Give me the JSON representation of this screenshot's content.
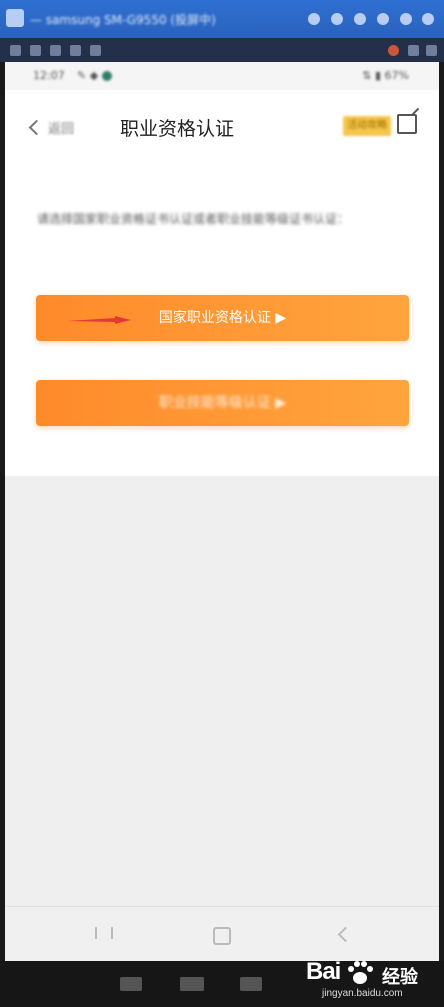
{
  "window": {
    "title": "— samsung SM-G9550 (投屏中)"
  },
  "status_bar": {
    "time": "12:07",
    "left_icons": "✎ ◆",
    "right_icons": "⇅ ▮ 67%"
  },
  "header": {
    "back_label": "返回",
    "title": "职业资格认证",
    "tag": "活动攻略"
  },
  "content": {
    "description": "请选择国家职业资格证书认证或者职业技能等级证书认证："
  },
  "buttons": {
    "national": "国家职业资格认证 ▶",
    "skill": "职业技能等级认证 ▶"
  },
  "watermark": {
    "logo": "Bai",
    "logo_cn": "经验",
    "url": "jingyan.baidu.com"
  },
  "colors": {
    "accent_orange": "#ff8a2a",
    "tag_yellow": "#f6c64a",
    "arrow_red": "#e53935",
    "window_blue": "#2f6fd2"
  }
}
